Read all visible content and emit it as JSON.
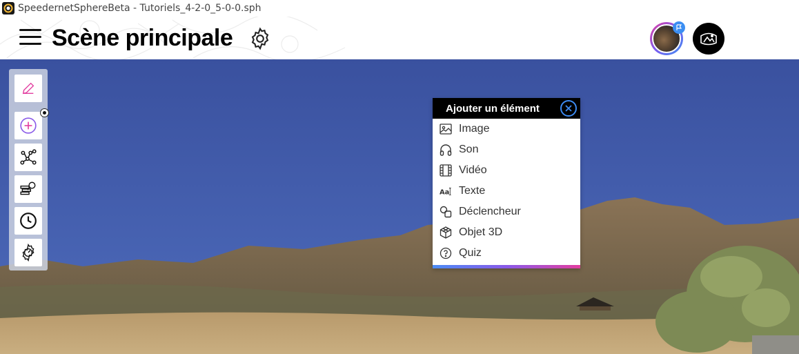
{
  "window": {
    "title": "SpeedernetSphereBeta - Tutoriels_4-2-0_5-0-0.sph"
  },
  "header": {
    "title": "Scène principale",
    "menu_icon": "hamburger-icon",
    "settings_icon": "gear-icon",
    "avatar_badge_icon": "flag-icon",
    "vr_icon": "vr-headset-icon"
  },
  "toolbar": {
    "tools": [
      {
        "name": "edit",
        "icon": "pencil-icon",
        "color": "#e23ea0"
      },
      {
        "name": "add",
        "icon": "plus-circle-icon",
        "color": "#7b5cf0"
      },
      {
        "name": "scene-graph",
        "icon": "nodes-icon"
      },
      {
        "name": "search-scenes",
        "icon": "search-stack-icon"
      },
      {
        "name": "history",
        "icon": "clock-icon"
      },
      {
        "name": "scene-settings",
        "icon": "settings-dial-icon"
      }
    ]
  },
  "add_panel": {
    "title": "Ajouter un élément",
    "close_icon": "close-icon",
    "items": [
      {
        "label": "Image",
        "icon": "image-icon"
      },
      {
        "label": "Son",
        "icon": "headphones-icon"
      },
      {
        "label": "Vidéo",
        "icon": "film-icon"
      },
      {
        "label": "Texte",
        "icon": "text-icon"
      },
      {
        "label": "Déclencheur",
        "icon": "trigger-shapes-icon"
      },
      {
        "label": "Objet 3D",
        "icon": "cube-icon"
      },
      {
        "label": "Quiz",
        "icon": "question-circle-icon"
      }
    ],
    "accent_gradient": [
      "#4b8cf5",
      "#8a5ae8",
      "#e23ea0"
    ]
  },
  "colors": {
    "accent_blue": "#3d8bf2",
    "accent_pink": "#e23ea0",
    "sky": "#3b56a8"
  }
}
